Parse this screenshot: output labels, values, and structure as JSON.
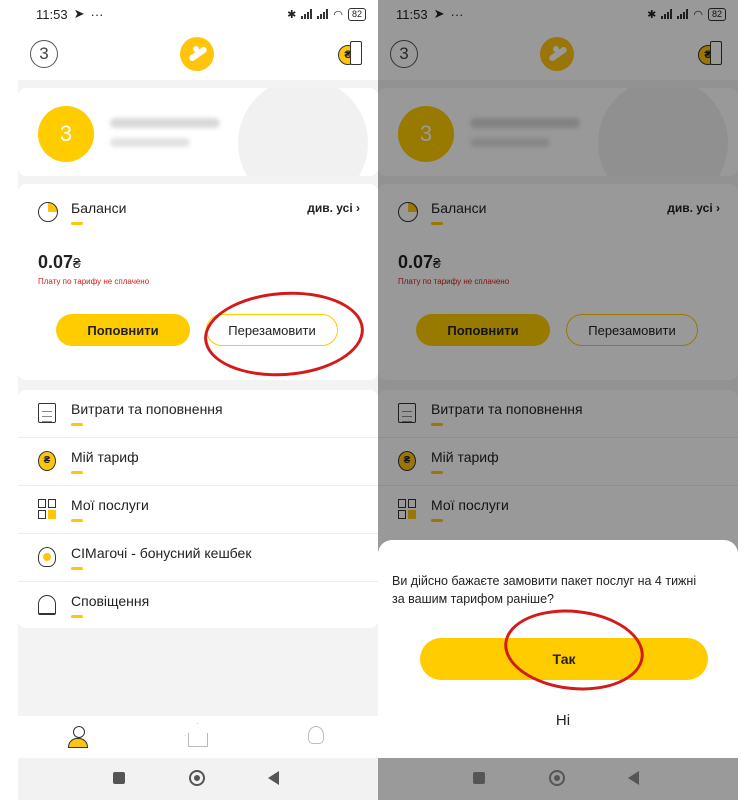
{
  "status": {
    "time": "11:53",
    "battery": "82"
  },
  "header": {
    "notifications_count": "3",
    "wallet_currency": "₴"
  },
  "profile": {
    "avatar_letter": "3"
  },
  "balance": {
    "title": "Баланси",
    "see_all": "див. усі",
    "amount": "0.07",
    "currency": "₴",
    "warning": "Плату по тарифу не сплачено",
    "topup_label": "Поповнити",
    "reorder_label": "Перезамовити"
  },
  "menu": {
    "items": [
      {
        "label": "Витрати та поповнення",
        "icon": "document-icon"
      },
      {
        "label": "Мій тариф",
        "icon": "hryvnia-coin-icon"
      },
      {
        "label": "Мої послуги",
        "icon": "services-grid-icon"
      },
      {
        "label": "СІМагочі - бонусний кешбек",
        "icon": "robot-icon"
      },
      {
        "label": "Сповіщення",
        "icon": "bell-icon"
      }
    ]
  },
  "bottom_nav": {
    "items": [
      "person-icon",
      "home-icon",
      "lightbulb-icon"
    ]
  },
  "dialog": {
    "question": "Ви дійсно бажаєте замовити пакет послуг на 4 тижні за вашим тарифом раніше?",
    "yes_label": "Так",
    "no_label": "Ні"
  },
  "colors": {
    "accent": "#ffcc00",
    "warning": "#d21e1e",
    "annotation": "#d51a1a"
  }
}
